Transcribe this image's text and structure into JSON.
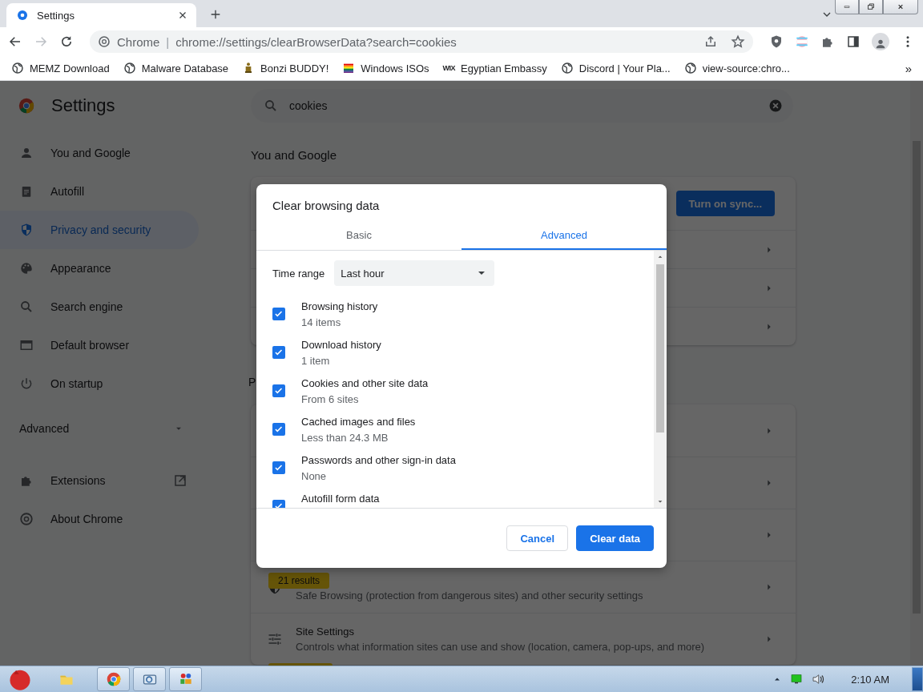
{
  "browser": {
    "tab": {
      "title": "Settings"
    },
    "address": {
      "site_label": "Chrome",
      "separator": "|",
      "url": "chrome://settings/clearBrowserData?search=cookies"
    },
    "bookmarks": [
      {
        "kind": "globe",
        "label": "MEMZ Download"
      },
      {
        "kind": "globe",
        "label": "Malware Database"
      },
      {
        "kind": "figure",
        "label": "Bonzi BUDDY!"
      },
      {
        "kind": "flag",
        "label": "Windows ISOs"
      },
      {
        "kind": "text",
        "mark": "WIX",
        "label": "Egyptian Embassy"
      },
      {
        "kind": "globe",
        "label": "Discord | Your Pla..."
      },
      {
        "kind": "globe",
        "label": "view-source:chro..."
      }
    ],
    "more_bookmarks": "»"
  },
  "settings": {
    "title": "Settings",
    "sidebar": {
      "items": [
        {
          "label": "You and Google",
          "selected": false
        },
        {
          "label": "Autofill",
          "selected": false
        },
        {
          "label": "Privacy and security",
          "selected": true
        },
        {
          "label": "Appearance",
          "selected": false
        },
        {
          "label": "Search engine",
          "selected": false
        },
        {
          "label": "Default browser",
          "selected": false
        },
        {
          "label": "On startup",
          "selected": false
        }
      ],
      "advanced": {
        "label": "Advanced",
        "expanded": false
      },
      "links": [
        {
          "label": "Extensions",
          "external": true
        },
        {
          "label": "About Chrome",
          "external": false
        }
      ]
    },
    "search": {
      "value": "cookies"
    },
    "sections": [
      {
        "heading": "You and Google",
        "rows": [
          {
            "button": "Turn on sync..."
          },
          {},
          {},
          {}
        ]
      },
      {
        "heading": "P",
        "rows": [
          {},
          {},
          {},
          {
            "title_badge": "21 results",
            "description": "Safe Browsing (protection from dangerous sites) and other security settings"
          },
          {
            "title": "Site Settings",
            "description": "Controls what information sites can use and show (location, camera, pop-ups, and more)"
          }
        ],
        "trailing_badge": true
      }
    ]
  },
  "dialog": {
    "title": "Clear browsing data",
    "tabs": [
      {
        "label": "Basic",
        "selected": false
      },
      {
        "label": "Advanced",
        "selected": true
      }
    ],
    "time_range": {
      "label": "Time range",
      "value": "Last hour"
    },
    "items": [
      {
        "label": "Browsing history",
        "detail": "14 items",
        "checked": true
      },
      {
        "label": "Download history",
        "detail": "1 item",
        "checked": true
      },
      {
        "label": "Cookies and other site data",
        "detail": "From 6 sites",
        "checked": true
      },
      {
        "label": "Cached images and files",
        "detail": "Less than 24.3 MB",
        "checked": true
      },
      {
        "label": "Passwords and other sign-in data",
        "detail": "None",
        "checked": true
      },
      {
        "label": "Autofill form data",
        "checked": true
      }
    ],
    "buttons": [
      {
        "kind": "secondary",
        "label": "Cancel"
      },
      {
        "kind": "primary",
        "label": "Clear data"
      }
    ]
  },
  "taskbar": {
    "apps": [
      {
        "kind": "folder",
        "pinned": false
      },
      {
        "kind": "chrome",
        "pinned": true
      },
      {
        "kind": "mail",
        "pinned": true
      },
      {
        "kind": "tiles",
        "pinned": true
      }
    ],
    "time": "2:10 AM"
  }
}
